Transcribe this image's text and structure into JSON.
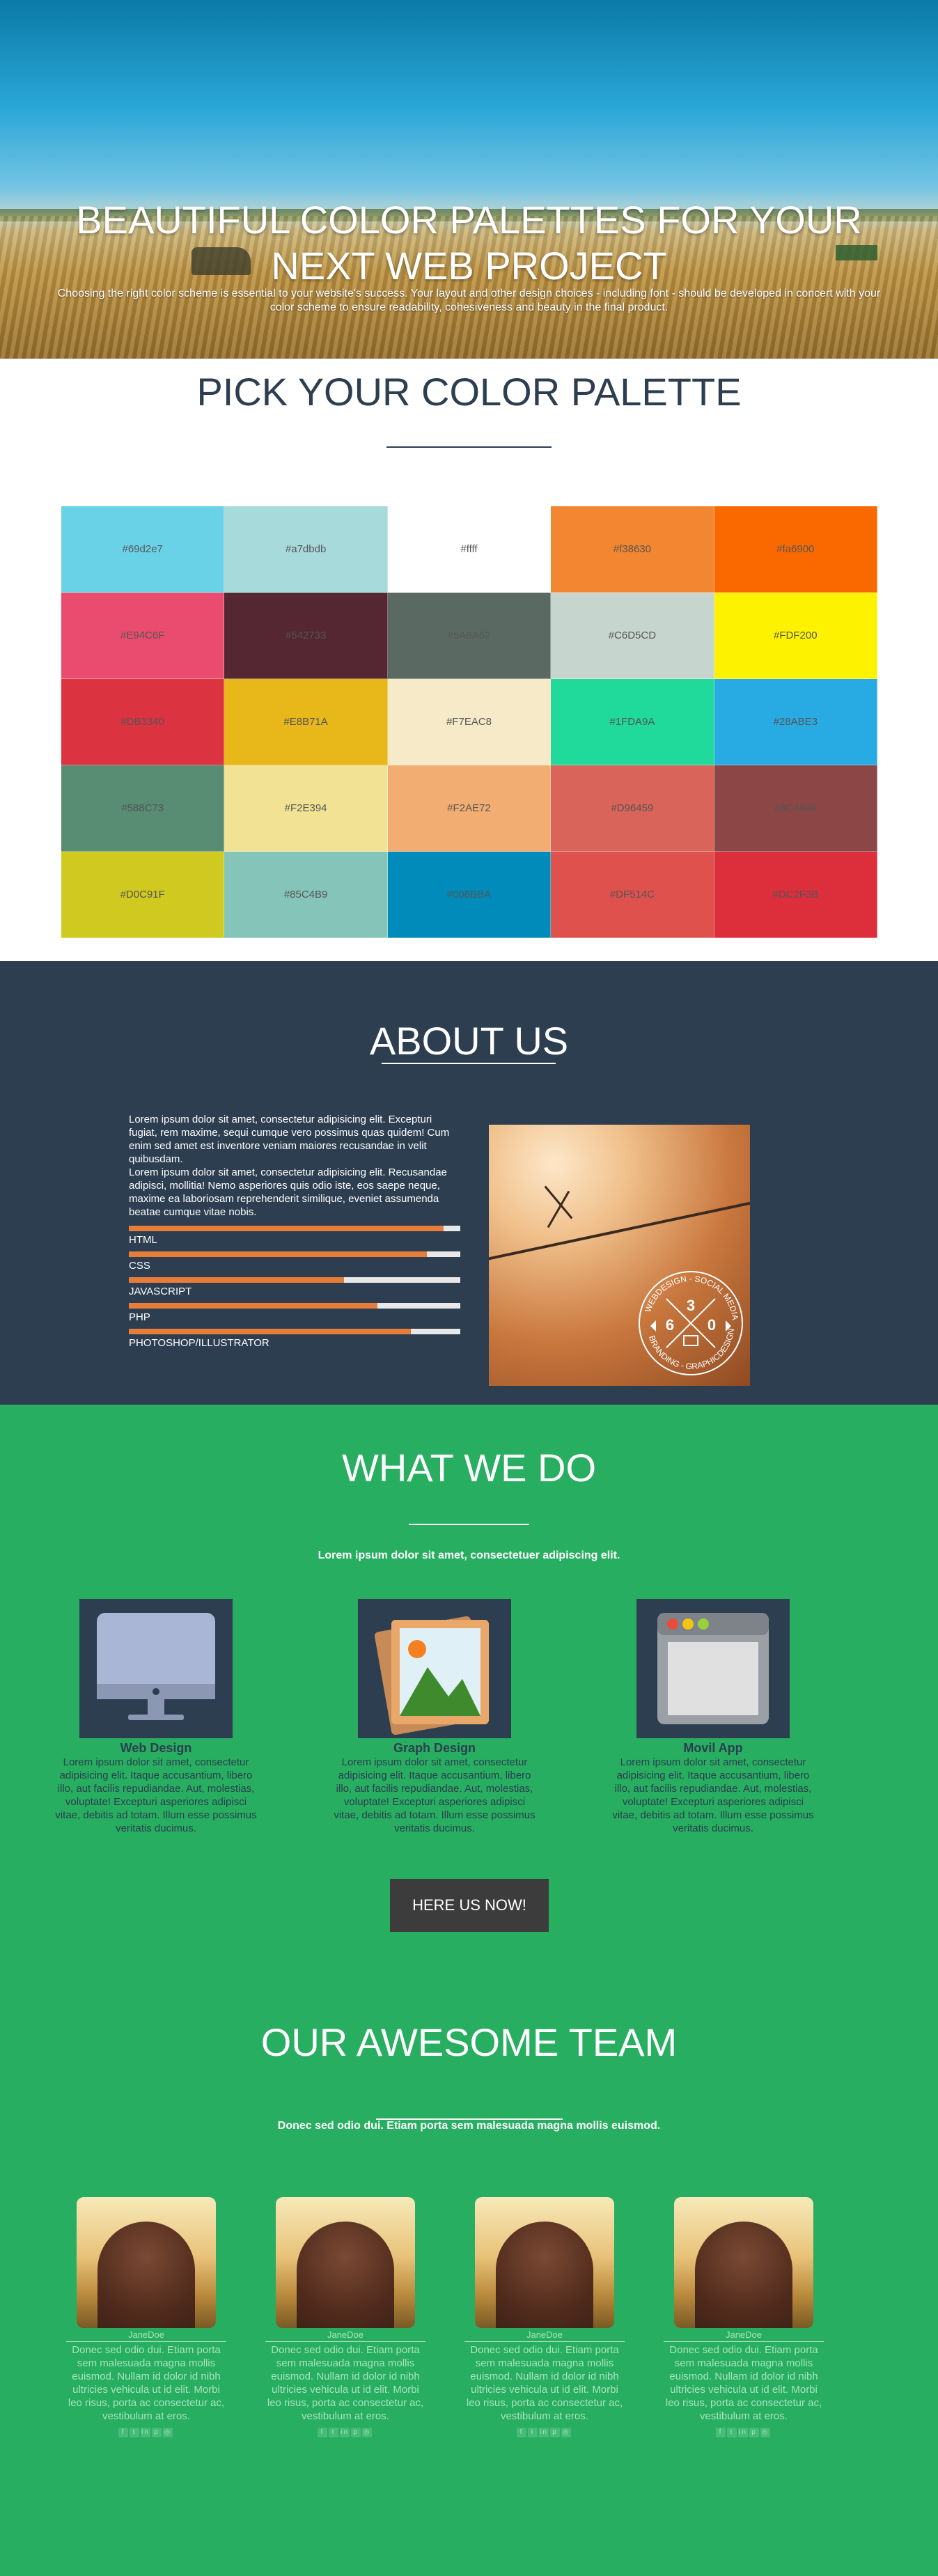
{
  "hero": {
    "title_line1": "BEAUTIFUL COLOR PALETTES FOR YOUR",
    "title_line2": "NEXT WEB PROJECT",
    "tagline": "Choosing the right color scheme is essential to your website's success. Your layout and other design choices - including font - should be developed in concert with your color scheme to ensure readability, cohesiveness and beauty in the final product."
  },
  "palette": {
    "heading": "PICK YOUR COLOR PALETTE",
    "swatches": [
      {
        "label": "#69d2e7",
        "color": "#69d2e7"
      },
      {
        "label": "#a7dbdb",
        "color": "#a7dbdb"
      },
      {
        "label": "#ffff",
        "color": "#ffffff"
      },
      {
        "label": "#f38630",
        "color": "#f38630"
      },
      {
        "label": "#fa6900",
        "color": "#fa6900"
      },
      {
        "label": "#E94C6F",
        "color": "#E94C6F"
      },
      {
        "label": "#542733",
        "color": "#542733"
      },
      {
        "label": "#5A6A62",
        "color": "#5A6A62"
      },
      {
        "label": "#C6D5CD",
        "color": "#C6D5CD"
      },
      {
        "label": "#FDF200",
        "color": "#FDF200"
      },
      {
        "label": "#DB3340",
        "color": "#DB3340"
      },
      {
        "label": "#E8B71A",
        "color": "#E8B71A"
      },
      {
        "label": "#F7EAC8",
        "color": "#F7EAC8"
      },
      {
        "label": "#1FDA9A",
        "color": "#1FDA9A"
      },
      {
        "label": "#28ABE3",
        "color": "#28ABE3"
      },
      {
        "label": "#588C73",
        "color": "#588C73"
      },
      {
        "label": "#F2E394",
        "color": "#F2E394"
      },
      {
        "label": "#F2AE72",
        "color": "#F2AE72"
      },
      {
        "label": "#D96459",
        "color": "#D96459"
      },
      {
        "label": "#8C4646",
        "color": "#8C4646"
      },
      {
        "label": "#D0C91F",
        "color": "#D0C91F"
      },
      {
        "label": "#85C4B9",
        "color": "#85C4B9"
      },
      {
        "label": "#008BBA",
        "color": "#008BBA"
      },
      {
        "label": "#DF514C",
        "color": "#DF514C"
      },
      {
        "label": "#DC2F3B",
        "color": "#DC2F3B"
      }
    ]
  },
  "about": {
    "heading": "ABOUT US",
    "paragraph1": "Lorem ipsum dolor sit amet, consectetur adipisicing elit. Excepturi fugiat, rem maxime, sequi cumque vero possimus quas quidem! Cum enim sed amet est inventore veniam maiores recusandae in velit quibusdam.",
    "paragraph2": "Lorem ipsum dolor sit amet, consectetur adipisicing elit. Recusandae adipisci, mollitia! Nemo asperiores quis odio iste, eos saepe neque, maxime ea laboriosam reprehenderit similique, eveniet assumenda beatae cumque vitae nobis.",
    "skills": [
      {
        "label": "HTML",
        "level": 0.95
      },
      {
        "label": "CSS",
        "level": 0.9
      },
      {
        "label": "JAVASCRIPT",
        "level": 0.65
      },
      {
        "label": "PHP",
        "level": 0.75
      },
      {
        "label": "PHOTOSHOP/ILLUSTRATOR",
        "level": 0.85
      }
    ],
    "badge": {
      "top_text": "WEBDESIGN - SOCIAL MEDIA",
      "bottom_text": "BRANDING - GRAPHICDESIGN",
      "num_top": "3",
      "num_left": "6",
      "num_right": "0"
    }
  },
  "services": {
    "heading": "WHAT WE DO",
    "subheading": "Lorem ipsum dolor sit amet, consectetuer adipiscing elit.",
    "items": [
      {
        "title": "Web Design",
        "icon": "monitor-icon",
        "text": "Lorem ipsum dolor sit amet, consectetur adipisicing elit. Itaque accusantium, libero illo, aut facilis repudiandae. Aut, molestias, voluptate! Excepturi asperiores adipisci vitae, debitis ad totam. Illum esse possimus veritatis ducimus."
      },
      {
        "title": "Graph Design",
        "icon": "picture-icon",
        "text": "Lorem ipsum dolor sit amet, consectetur adipisicing elit. Itaque accusantium, libero illo, aut facilis repudiandae. Aut, molestias, voluptate! Excepturi asperiores adipisci vitae, debitis ad totam. Illum esse possimus veritatis ducimus."
      },
      {
        "title": "Movil App",
        "icon": "app-window-icon",
        "text": "Lorem ipsum dolor sit amet, consectetur adipisicing elit. Itaque accusantium, libero illo, aut facilis repudiandae. Aut, molestias, voluptate! Excepturi asperiores adipisci vitae, debitis ad totam. Illum esse possimus veritatis ducimus."
      }
    ],
    "cta": "HERE US NOW!"
  },
  "team": {
    "heading": "OUR AWESOME TEAM",
    "subheading": "Donec sed odio dui. Etiam porta sem malesuada magna mollis euismod.",
    "members": [
      {
        "name": "JaneDoe",
        "bio": "Donec sed odio dui. Etiam porta sem malesuada magna mollis euismod. Nullam id dolor id nibh ultricies vehicula ut id elit. Morbi leo risus, porta ac consectetur ac, vestibulum at eros."
      },
      {
        "name": "JaneDoe",
        "bio": "Donec sed odio dui. Etiam porta sem malesuada magna mollis euismod. Nullam id dolor id nibh ultricies vehicula ut id elit. Morbi leo risus, porta ac consectetur ac, vestibulum at eros."
      },
      {
        "name": "JaneDoe",
        "bio": "Donec sed odio dui. Etiam porta sem malesuada magna mollis euismod. Nullam id dolor id nibh ultricies vehicula ut id elit. Morbi leo risus, porta ac consectetur ac, vestibulum at eros."
      },
      {
        "name": "JaneDoe",
        "bio": "Donec sed odio dui. Etiam porta sem malesuada magna mollis euismod. Nullam id dolor id nibh ultricies vehicula ut id elit. Morbi leo risus, porta ac consectetur ac, vestibulum at eros."
      }
    ],
    "social_icons": [
      "facebook-icon",
      "twitter-icon",
      "linkedin-icon",
      "pinterest-icon",
      "instagram-icon"
    ]
  }
}
